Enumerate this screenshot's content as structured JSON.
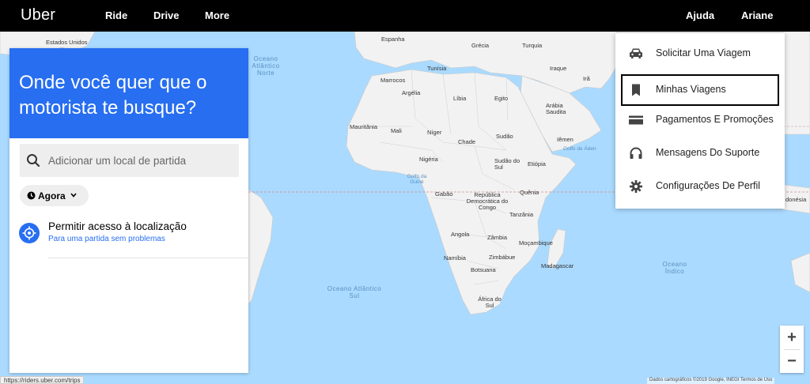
{
  "nav": {
    "logo": "Uber",
    "ride": "Ride",
    "drive": "Drive",
    "more": "More",
    "help": "Ajuda",
    "user": "Ariane"
  },
  "panel": {
    "title": "Onde você quer que o motorista te busque?",
    "search_placeholder": "Adicionar um local de partida",
    "time_label": "Agora",
    "location_title": "Permitir acesso à localização",
    "location_subtitle": "Para uma partida sem problemas"
  },
  "menu": {
    "items": [
      {
        "label": "Solicitar Uma Viagem",
        "icon": "car-icon"
      },
      {
        "label": "Minhas Viagens",
        "icon": "receipt-icon"
      },
      {
        "label": "Pagamentos E Promoções",
        "icon": "card-icon"
      },
      {
        "label": "Mensagens Do Suporte",
        "icon": "headset-icon"
      },
      {
        "label": "Configurações De Perfil",
        "icon": "gear-icon"
      }
    ]
  },
  "map": {
    "labels": {
      "estados_unidos": "Estados Unidos",
      "espanha": "Espanha",
      "grecia": "Grécia",
      "turquia": "Turquia",
      "tunisia": "Tunísia",
      "marrocos": "Marrocos",
      "iraque": "Iraque",
      "ira": "Irã",
      "argelia": "Argélia",
      "libia": "Líbia",
      "egito": "Egito",
      "arabia": "Arábia Saudita",
      "mauritania": "Mauritânia",
      "mali": "Mali",
      "niger": "Níger",
      "chade": "Chade",
      "sudao": "Sudão",
      "iemen": "Iêmen",
      "nigeria": "Nigéria",
      "sudao_sul": "Sudão do Sul",
      "etiopia": "Etiópia",
      "gabao": "Gabão",
      "rd_congo": "República Democrática do Congo",
      "quenia": "Quênia",
      "tanzania": "Tanzânia",
      "angola": "Angola",
      "zambia": "Zâmbia",
      "mocambique": "Moçambique",
      "namibia": "Namíbia",
      "zimbabue": "Zimbábue",
      "botsuana": "Botsuana",
      "madagascar": "Madagascar",
      "africa_sul": "África do Sul",
      "indonesia": "donésia",
      "golfo_guine": "Golfo da Guiné",
      "golfo_aden": "Golfo de Áden",
      "ocean_north": "Oceano Atlântico Norte",
      "ocean_south": "Oceano Atlântico Sul",
      "ocean_indian": "Oceano Índico"
    }
  },
  "zoom": {
    "plus": "+",
    "minus": "−"
  },
  "status_url": "https://riders.uber.com/trips",
  "credits": "Dados cartográficos ©2019 Google, INEGI   Termos de Uso"
}
